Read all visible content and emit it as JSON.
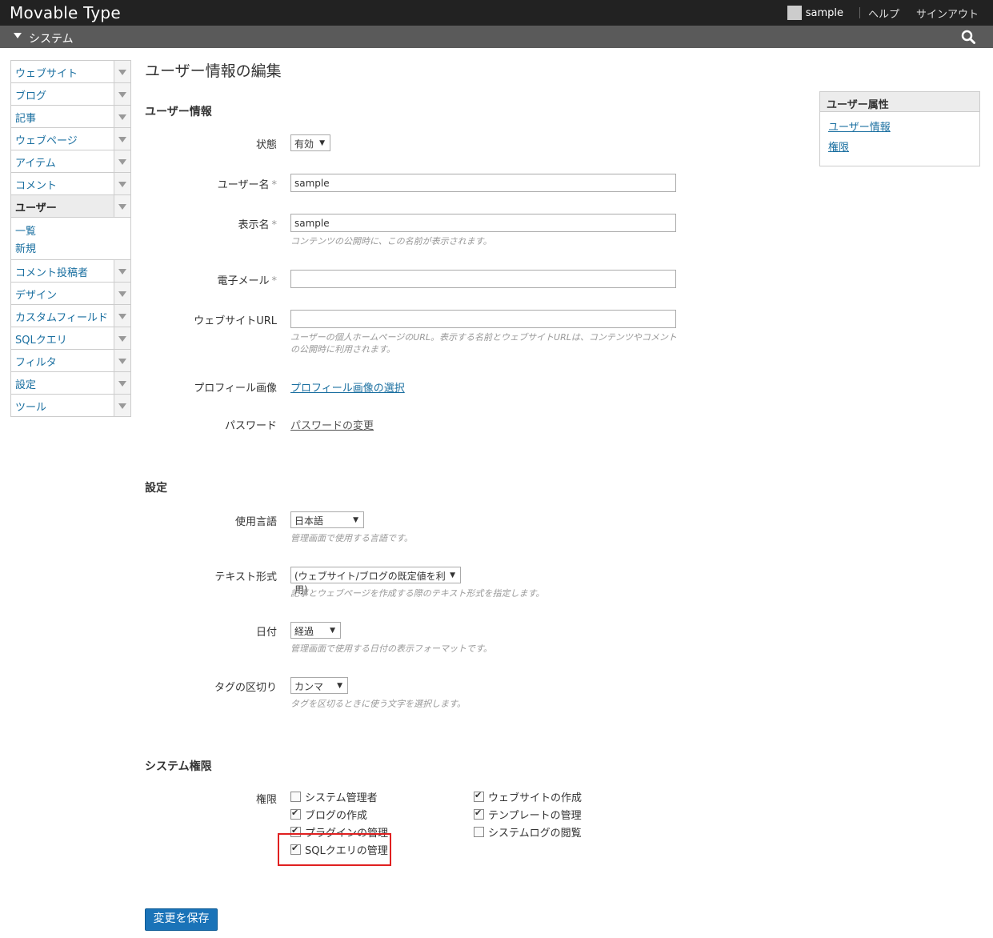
{
  "header": {
    "app_title": "Movable Type",
    "user_name": "sample",
    "help_label": "ヘルプ",
    "signout_label": "サインアウト"
  },
  "subheader": {
    "scope_label": "システム"
  },
  "sidebar": {
    "items": [
      {
        "label": "ウェブサイト"
      },
      {
        "label": "ブログ"
      },
      {
        "label": "記事"
      },
      {
        "label": "ウェブページ"
      },
      {
        "label": "アイテム"
      },
      {
        "label": "コメント"
      },
      {
        "label": "ユーザー"
      },
      {
        "label": "コメント投稿者"
      },
      {
        "label": "デザイン"
      },
      {
        "label": "カスタムフィールド"
      },
      {
        "label": "SQLクエリ"
      },
      {
        "label": "フィルタ"
      },
      {
        "label": "設定"
      },
      {
        "label": "ツール"
      }
    ],
    "submenu": [
      "一覧",
      "新規"
    ]
  },
  "page": {
    "title": "ユーザー情報の編集"
  },
  "user_info": {
    "heading": "ユーザー情報",
    "status_label": "状態",
    "status_value": "有効",
    "username_label": "ユーザー名",
    "username_value": "sample",
    "displayname_label": "表示名",
    "displayname_value": "sample",
    "displayname_hint": "コンテンツの公開時に、この名前が表示されます。",
    "email_label": "電子メール",
    "email_value": "",
    "url_label": "ウェブサイトURL",
    "url_value": "",
    "url_hint": "ユーザーの個人ホームページのURL。表示する名前とウェブサイトURLは、コンテンツやコメントの公開時に利用されます。",
    "profile_label": "プロフィール画像",
    "profile_link": "プロフィール画像の選択",
    "password_label": "パスワード",
    "password_link": "パスワードの変更",
    "required_mark": "*"
  },
  "settings": {
    "heading": "設定",
    "language_label": "使用言語",
    "language_value": "日本語",
    "language_hint": "管理画面で使用する言語です。",
    "textformat_label": "テキスト形式",
    "textformat_value": "(ウェブサイト/ブログの既定値を利用)",
    "textformat_hint": "記事とウェブページを作成する際のテキスト形式を指定します。",
    "date_label": "日付",
    "date_value": "経過",
    "date_hint": "管理画面で使用する日付の表示フォーマットです。",
    "tagdelim_label": "タグの区切り",
    "tagdelim_value": "カンマ",
    "tagdelim_hint": "タグを区切るときに使う文字を選択します。"
  },
  "permissions": {
    "heading": "システム権限",
    "label": "権限",
    "items": [
      {
        "label": "システム管理者",
        "checked": false
      },
      {
        "label": "ウェブサイトの作成",
        "checked": true
      },
      {
        "label": "ブログの作成",
        "checked": true
      },
      {
        "label": "テンプレートの管理",
        "checked": true
      },
      {
        "label": "プラグインの管理",
        "checked": true
      },
      {
        "label": "システムログの閲覧",
        "checked": false
      },
      {
        "label": "SQLクエリの管理",
        "checked": true
      }
    ]
  },
  "save_button": "変更を保存",
  "widget": {
    "title": "ユーザー属性",
    "links": [
      "ユーザー情報",
      "権限"
    ]
  }
}
